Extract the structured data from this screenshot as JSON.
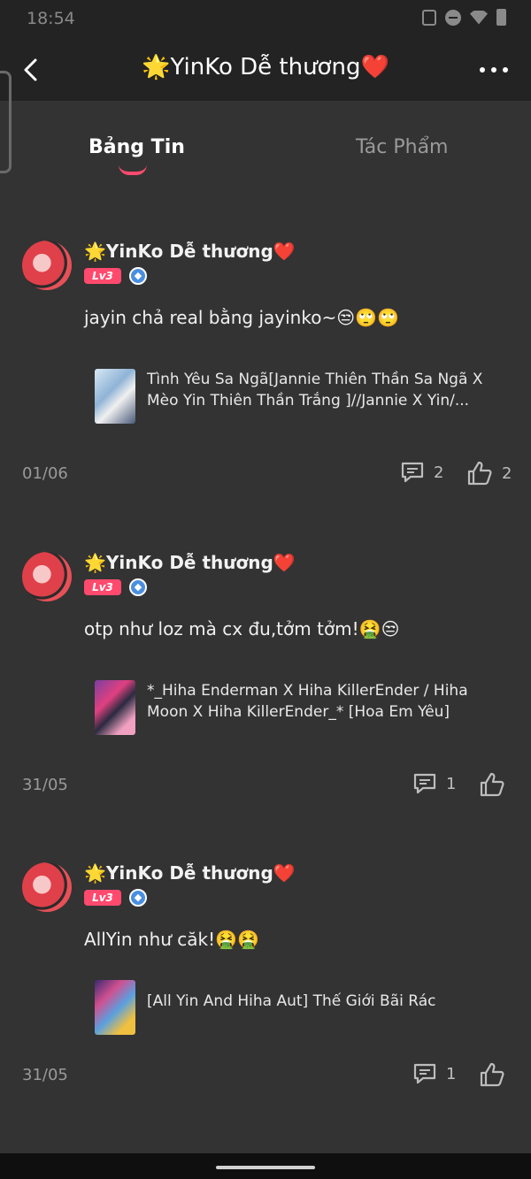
{
  "status": {
    "time": "18:54"
  },
  "header": {
    "title": "🌟YinKo Dễ thương❤️"
  },
  "tabs": [
    {
      "label": "Bảng Tin"
    },
    {
      "label": "Tác Phẩm"
    }
  ],
  "posts": [
    {
      "author": "🌟YinKo Dễ thương❤️",
      "level": "Lv3",
      "text": "jayin chả real bằng jayinko~😒🙄🙄",
      "work_title": "Tình Yêu Sa Ngã[Jannie Thiên Thần Sa Ngã X Mèo Yin Thiên Thần Trắng ]//Jannie X Yin/...",
      "date": "01/06",
      "comments": "2",
      "likes": "2"
    },
    {
      "author": "🌟YinKo Dễ thương❤️",
      "level": "Lv3",
      "text": "otp như loz mà cx đu,tởm tởm!🤮😒",
      "work_title": "*_Hiha Enderman X Hiha KillerEnder / Hiha Moon X Hiha KillerEnder_* [Hoa Em Yêu]",
      "date": "31/05",
      "comments": "1",
      "likes": ""
    },
    {
      "author": "🌟YinKo Dễ thương❤️",
      "level": "Lv3",
      "text": "AllYin như căk!🤮🤮",
      "work_title": "[All Yin And Hiha Aut] Thế Giới Bãi Rác",
      "date": "31/05",
      "comments": "1",
      "likes": ""
    }
  ]
}
